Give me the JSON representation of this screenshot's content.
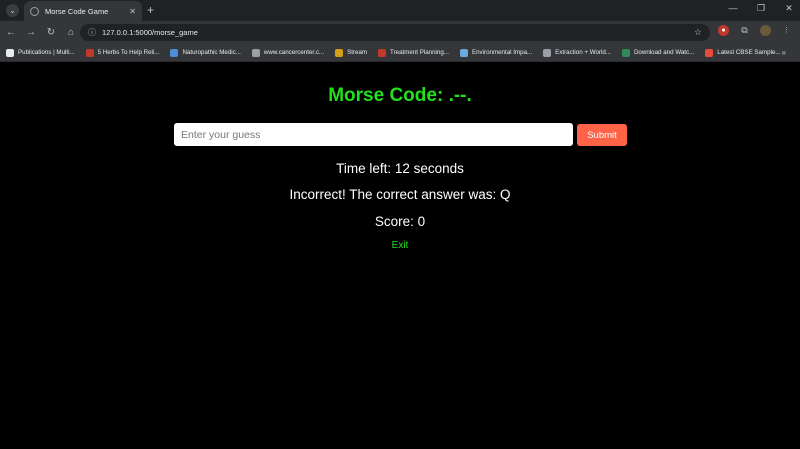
{
  "browser": {
    "tab_title": "Morse Code Game",
    "url": "127.0.0.1:5000/morse_game",
    "bookmarks": [
      {
        "label": "Publications | Multi...",
        "color": "#e8eaed"
      },
      {
        "label": "5 Herbs To Help Reli...",
        "color": "#c0392b"
      },
      {
        "label": "Naturopathic Medic...",
        "color": "#4a8fd6"
      },
      {
        "label": "www.cancercenter.c...",
        "color": "#9aa0a6"
      },
      {
        "label": "Stream",
        "color": "#d4a017"
      },
      {
        "label": "Treatment Planning...",
        "color": "#c0392b"
      },
      {
        "label": "Environmental Impa...",
        "color": "#6fa8dc"
      },
      {
        "label": "Extraction + World...",
        "color": "#9aa0a6"
      },
      {
        "label": "Download and Watc...",
        "color": "#2e8b57"
      },
      {
        "label": "Latest CBSE Sample...",
        "color": "#e74c3c"
      }
    ]
  },
  "game": {
    "title": "Morse Code: .--.",
    "input_placeholder": "Enter your guess",
    "submit_label": "Submit",
    "timer_text": "Time left: 12 seconds",
    "feedback_text": "Incorrect! The correct answer was: Q",
    "score_text": "Score: 0",
    "exit_label": "Exit"
  },
  "colors": {
    "title": "#22e01b",
    "submit_bg": "#ff6347",
    "background": "#000000"
  }
}
